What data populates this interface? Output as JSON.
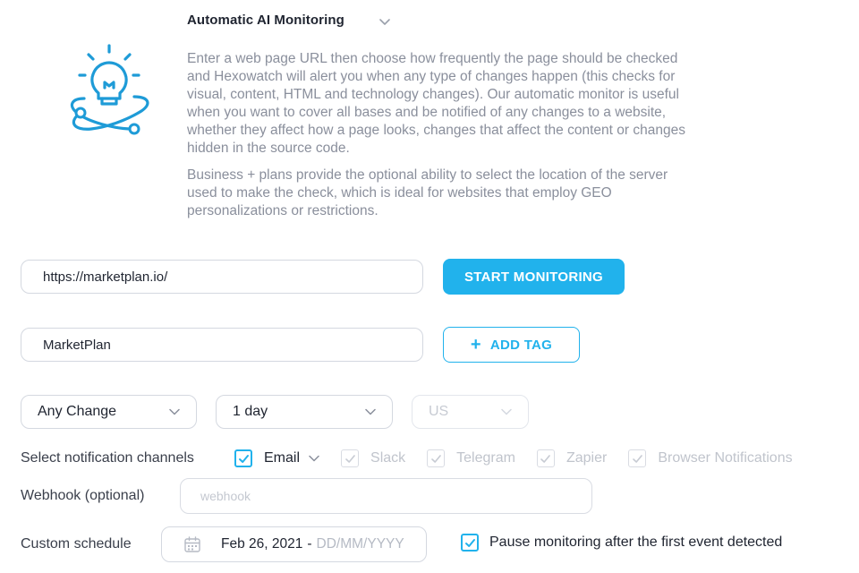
{
  "header": {
    "title": "Automatic AI Monitoring",
    "expand_icon": "chevron-down-icon"
  },
  "logo_icon": "lightbulb-orbit-icon",
  "description": {
    "paragraph1": "Enter a web page URL then choose how frequently the page should be checked and Hexowatch will alert you when any type of changes happen (this checks for visual, content, HTML and technology changes). Our automatic monitor is useful when you want to cover all bases and be notified of any changes to a website, whether they affect how a page looks, changes that affect the content or changes hidden in the source code.",
    "paragraph2": "Business + plans provide the optional ability to select the location of the server used to make the check, which is ideal for websites that employ GEO personalizations or restrictions."
  },
  "url_input": {
    "value": "https://marketplan.io/"
  },
  "start_button": {
    "label": "START MONITORING"
  },
  "tag_input": {
    "value": "MarketPlan"
  },
  "add_tag_button": {
    "label": "ADD TAG",
    "icon": "plus-icon"
  },
  "selects": {
    "change_type": "Any Change",
    "frequency": "1 day",
    "location": "US"
  },
  "notifications": {
    "label": "Select notification channels",
    "channels": [
      {
        "label": "Email",
        "checked": true
      },
      {
        "label": "Slack",
        "checked": false
      },
      {
        "label": "Telegram",
        "checked": false
      },
      {
        "label": "Zapier",
        "checked": false
      },
      {
        "label": "Browser Notifications",
        "checked": false
      }
    ]
  },
  "webhook": {
    "label": "Webhook (optional)",
    "placeholder": "webhook"
  },
  "schedule": {
    "label": "Custom schedule",
    "start_date": "Feb 26, 2021",
    "separator": "-",
    "end_placeholder": "DD/MM/YYYY",
    "calendar_icon": "calendar-icon"
  },
  "pause_option": {
    "label": "Pause monitoring after the first event detected",
    "checked": true
  },
  "colors": {
    "accent": "#21b2ec",
    "text": "#1f2430",
    "muted": "#8a8f9c",
    "border": "#d4d8e0"
  }
}
